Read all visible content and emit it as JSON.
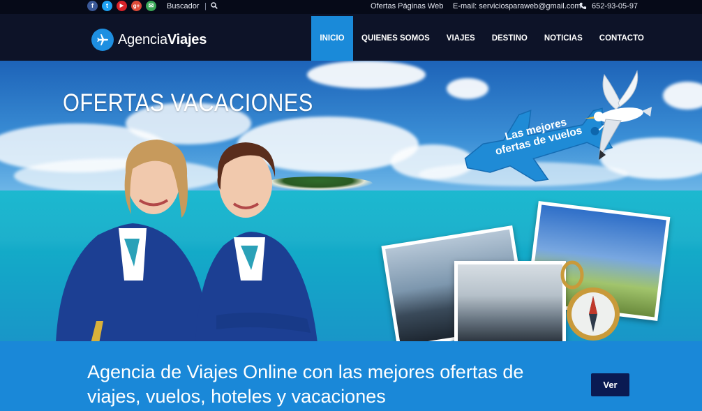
{
  "topbar": {
    "social": [
      {
        "name": "facebook-icon",
        "glyph": "f",
        "color": "#3b5998"
      },
      {
        "name": "twitter-icon",
        "glyph": "t",
        "color": "#1da1f2"
      },
      {
        "name": "youtube-icon",
        "glyph": "▶",
        "color": "#d8232a"
      },
      {
        "name": "google-plus-icon",
        "glyph": "g+",
        "color": "#dd4b39"
      },
      {
        "name": "email-icon",
        "glyph": "✉",
        "color": "#3aa757"
      }
    ],
    "search_label": "Buscador",
    "separator": "|",
    "offers_link": "Ofertas Páginas Web",
    "email": "E-mail: serviciosparaweb@gmail.com",
    "phone": "652-93-05-97"
  },
  "logo": {
    "text_light": "Agencia",
    "text_bold": "Viajes"
  },
  "nav": {
    "items": [
      {
        "label": "INICIO",
        "active": true
      },
      {
        "label": "QUIENES SOMOS",
        "active": false
      },
      {
        "label": "VIAJES",
        "active": false
      },
      {
        "label": "DESTINO",
        "active": false
      },
      {
        "label": "NOTICIAS",
        "active": false
      },
      {
        "label": "CONTACTO",
        "active": false
      }
    ]
  },
  "hero": {
    "title": "OFERTAS VACACIONES",
    "tag_line1": "Las mejores",
    "tag_line2": "ofertas de vuelos"
  },
  "banner": {
    "text": "Agencia de Viajes Online con las mejores ofertas de viajes, vuelos, hoteles y vacaciones",
    "button_label": "Ver"
  },
  "colors": {
    "accent": "#1a8ad9",
    "nav_bg": "#0d1328",
    "topbar_bg": "#060a18",
    "button_bg": "#0a1a52"
  }
}
